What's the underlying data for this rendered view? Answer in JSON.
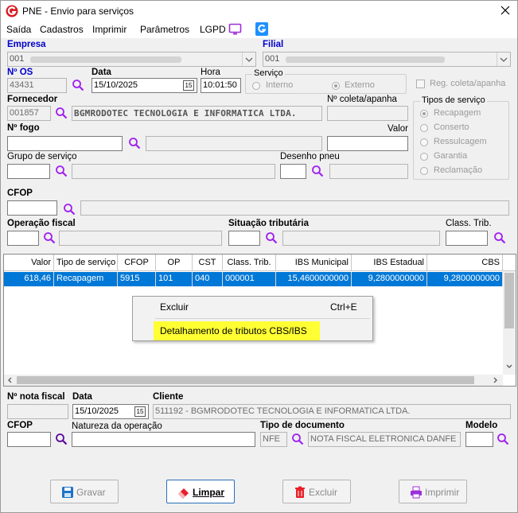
{
  "window": {
    "title": "PNE - Envio para serviços"
  },
  "menu": {
    "items": [
      "Saída",
      "Cadastros",
      "Imprimir",
      "Parâmetros",
      "LGPD"
    ]
  },
  "header": {
    "empresa_label": "Empresa",
    "empresa_value": "001",
    "filial_label": "Filial",
    "filial_value": "001",
    "os_label": "Nº  OS",
    "os_value": "43431",
    "data_label": "Data",
    "data_value": "15/10/2025",
    "hora_label": "Hora",
    "hora_value": "10:01:50",
    "servico_group": "Serviço",
    "servico_interno": "Interno",
    "servico_externo": "Externo",
    "reg_coleta_label": "Reg. coleta/apanha",
    "fornecedor_label": "Fornecedor",
    "fornecedor_code": "001857",
    "fornecedor_name": "BGMRODOTEC TECNOLOGIA E INFORMATICA LTDA.",
    "coleta_label": "Nº coleta/apanha",
    "tipos_group": "Tipos de serviço",
    "tipos": [
      "Recapagem",
      "Conserto",
      "Ressulcagem",
      "Garantia",
      "Reclamação"
    ],
    "fogo_label": "Nº  fogo",
    "valor_label": "Valor",
    "grupo_label": "Grupo de serviço",
    "desenho_label": "Desenho pneu",
    "cfop_label": "CFOP",
    "operacao_label": "Operação fiscal",
    "situacao_label": "Situação tributária",
    "classtrib_label": "Class. Trib."
  },
  "grid": {
    "columns": [
      "Valor",
      "Tipo de serviço",
      "CFOP",
      "OP",
      "CST",
      "Class. Trib.",
      "IBS Municipal",
      "IBS Estadual",
      "CBS"
    ],
    "rows": [
      [
        "618,46",
        "Recapagem",
        "5915",
        "101",
        "040",
        "000001",
        "15,4600000000",
        "9,2800000000",
        "9,2800000000"
      ]
    ]
  },
  "context_menu": {
    "items": [
      {
        "label": "Excluir",
        "shortcut": "Ctrl+E"
      },
      {
        "label": "Detalhamento de tributos CBS/IBS",
        "shortcut": ""
      }
    ],
    "highlight_color": "#ffff33"
  },
  "footer": {
    "nota_label": "Nº nota fiscal",
    "data_label": "Data",
    "data_value": "15/10/2025",
    "cliente_label": "Cliente",
    "cliente_value": "511192 - BGMRODOTEC TECNOLOGIA E INFORMATICA LTDA.",
    "cfop_label": "CFOP",
    "natureza_label": "Natureza da operação",
    "tipo_doc_label": "Tipo de documento",
    "tipo_doc_code": "NFE",
    "tipo_doc_name": "NOTA FISCAL ELETRONICA DANFE",
    "modelo_label": "Modelo"
  },
  "buttons": {
    "gravar": "Gravar",
    "limpar": "Limpar",
    "excluir": "Excluir",
    "imprimir": "Imprimir"
  },
  "colors": {
    "accent": "#0000cc",
    "icon_purple": "#a020f0",
    "selection": "#0078d7"
  }
}
